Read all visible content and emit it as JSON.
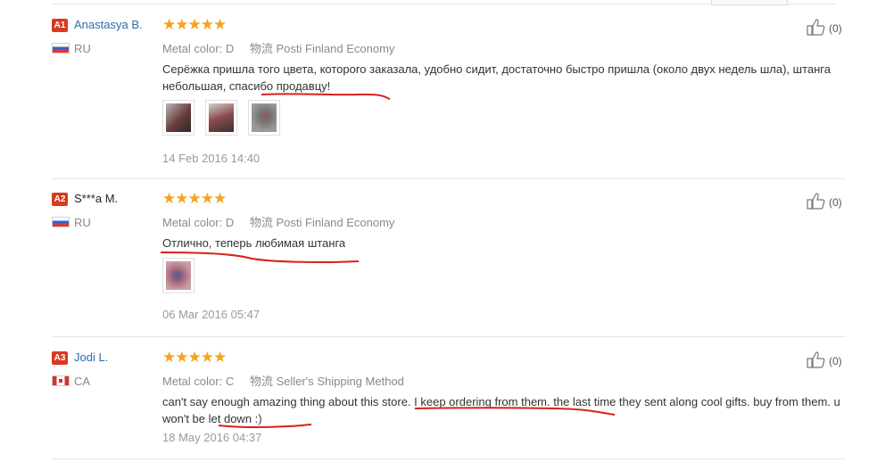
{
  "colors": {
    "accent_link": "#2a6db0",
    "badge": "#d83a1f",
    "stars": "#f5a31f",
    "underline": "#d9201c"
  },
  "reviews": [
    {
      "badge": "A1",
      "name": "Anastasya B.",
      "country": "RU",
      "stars": "★★★★★",
      "metal_label": "Metal color:",
      "metal_value": "D",
      "logistics_label": "物流",
      "shipping": "Posti Finland Economy",
      "text": "Серёжка пришла того цвета, которого заказала, удобно сидит, достаточно быстро пришла (около двух недель шла), штанга небольшая, спасибо продавцу!",
      "date": "14 Feb 2016 14:40",
      "helpful": "(0)"
    },
    {
      "badge": "A2",
      "name": "S***a M.",
      "country": "RU",
      "stars": "★★★★★",
      "metal_label": "Metal color:",
      "metal_value": "D",
      "logistics_label": "物流",
      "shipping": "Posti Finland Economy",
      "text": "Отлично, теперь любимая штанга",
      "date": "06 Mar 2016 05:47",
      "helpful": "(0)"
    },
    {
      "badge": "A3",
      "name": "Jodi L.",
      "country": "CA",
      "stars": "★★★★★",
      "metal_label": "Metal color:",
      "metal_value": "C",
      "logistics_label": "物流",
      "shipping": "Seller's Shipping Method",
      "text": "can't say enough amazing thing about this store. I keep ordering from them. the last time they sent along cool gifts. buy from them. u won't be let down :)",
      "date": "18 May 2016 04:37",
      "helpful": "(0)"
    }
  ]
}
